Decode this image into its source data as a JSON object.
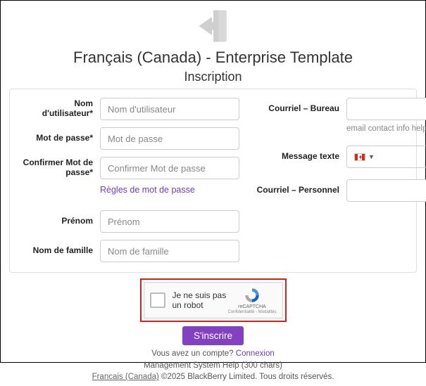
{
  "header": {
    "title": "Français (Canada) - Enterprise Template",
    "subtitle": "Inscription"
  },
  "form": {
    "username": {
      "label": "Nom d'utilisateur*",
      "placeholder": "Nom d'utilisateur"
    },
    "password": {
      "label": "Mot de passe*",
      "placeholder": "Mot de passe"
    },
    "confirm": {
      "label": "Confirmer Mot de passe*",
      "placeholder": "Confirmer Mot de passe"
    },
    "rules_link": "Règles de mot de passe",
    "firstname": {
      "label": "Prénom",
      "placeholder": "Prénom"
    },
    "lastname": {
      "label": "Nom de famille",
      "placeholder": "Nom de famille"
    },
    "email_work": {
      "label": "Courriel – Bureau",
      "help": "email contact info help text"
    },
    "sms": {
      "label": "Message texte"
    },
    "email_personal": {
      "label": "Courriel – Personnel"
    }
  },
  "captcha": {
    "label": "Je ne suis pas un robot",
    "brand": "reCAPTCHA",
    "terms": "Confidentialité - Modalités"
  },
  "actions": {
    "submit": "S'inscrire"
  },
  "footer": {
    "have_account": "Vous avez un compte? ",
    "login": "Connexion",
    "help": "Management System Help (300 chars)",
    "lang": "Francais (Canada)",
    "copyright": "  ©2025 BlackBerry Limited. Tous droits réservés."
  }
}
